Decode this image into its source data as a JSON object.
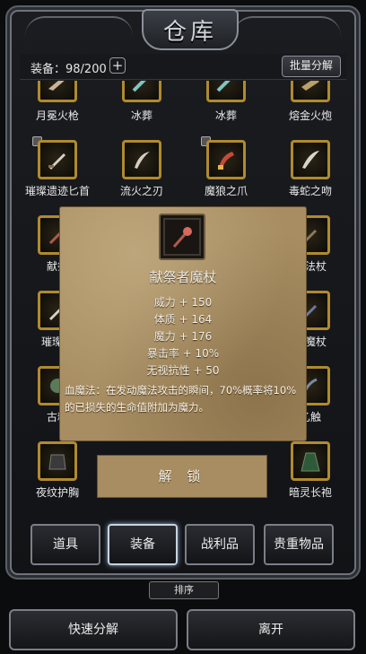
{
  "header": {
    "title": "仓库"
  },
  "toolbar": {
    "capacity_label": "装备：98/200",
    "plus_label": "+",
    "bulk_label": "批量分解"
  },
  "grid": {
    "rows": [
      [
        "月冕火枪",
        "冰葬",
        "冰葬",
        "熔金火炮"
      ],
      [
        "璀璨遗迹匕首",
        "流火之刃",
        "魔狼之爪",
        "毒蛇之吻"
      ],
      [
        "献祭",
        "",
        "",
        "迹法杖"
      ],
      [
        "璀璨遗",
        "",
        "",
        "刺魔杖"
      ],
      [
        "古精",
        "",
        "",
        "乙触"
      ],
      [
        "夜纹护胸",
        "",
        "",
        "暗灵长袍"
      ]
    ]
  },
  "popup": {
    "name": "献祭者魔杖",
    "stats": [
      "威力 + 150",
      "体质 + 164",
      "魔力 + 176",
      "暴击率 + 10%",
      "无视抗性 + 50"
    ],
    "desc": "血魔法：在发动魔法攻击的瞬间，70%概率将10%的已损失的生命值附加为魔力。",
    "unlock_label": "解 锁"
  },
  "tabs": [
    "道具",
    "装备",
    "战利品",
    "贵重物品"
  ],
  "active_tab": "装备",
  "sort_label": "排序",
  "footer": {
    "quick_label": "快速分解",
    "leave_label": "离开"
  },
  "colors": {
    "rare_border": "#b08a2e",
    "parchment": "#a88d62"
  },
  "icons": [
    "lock-icon",
    "plus-icon",
    "staff-icon",
    "dagger-icon",
    "claw-icon",
    "armor-icon"
  ]
}
